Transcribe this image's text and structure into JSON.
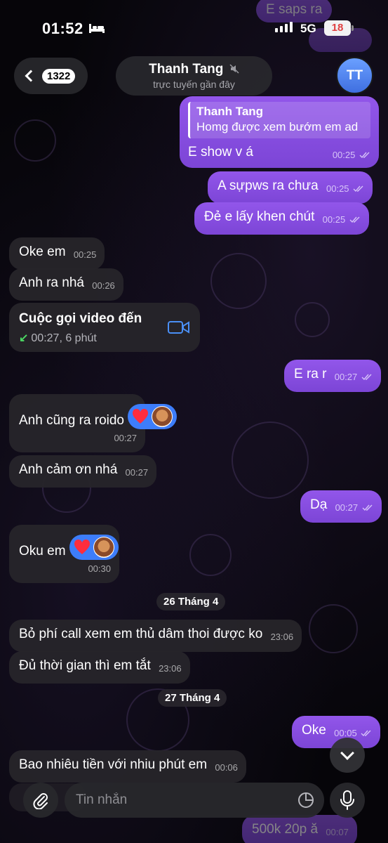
{
  "status_bar": {
    "time": "01:52",
    "network": "5G",
    "battery": "18"
  },
  "header": {
    "back_count": "1322",
    "contact_name": "Thanh Tang",
    "last_seen": "trực tuyến gần đây",
    "avatar_initials": "TT"
  },
  "colors": {
    "outgoing_bubble": "#8a4fe3",
    "incoming_bubble": "#26242a",
    "reaction_pill": "#3d7dfa",
    "accent_blue": "#3f6fe0"
  },
  "top_partial": {
    "text_a": "E saps ra"
  },
  "messages": {
    "m1": {
      "reply_author": "Thanh Tang",
      "reply_text": "Homg được xem bướm em ad",
      "text": "E show v á",
      "time": "00:25"
    },
    "m2": {
      "text": "A sựpws ra chưa",
      "time": "00:25"
    },
    "m3": {
      "text": "Đẻ e lấy khen chút",
      "time": "00:25"
    },
    "m4": {
      "text": "Oke em",
      "time": "00:25"
    },
    "m5": {
      "text": "Anh ra nhá",
      "time": "00:26"
    },
    "m6": {
      "title": "Cuộc gọi video đến",
      "sub_arrow": "↙",
      "sub": "00:27, 6 phút"
    },
    "m7": {
      "text": "E ra r",
      "time": "00:27"
    },
    "m8": {
      "text": "Anh cũng ra roido",
      "time": "00:27"
    },
    "m9": {
      "text": "Anh cảm ơn nhá",
      "time": "00:27"
    },
    "m10": {
      "text": "Dạ",
      "time": "00:27"
    },
    "m11": {
      "text": "Oku em",
      "time": "00:30"
    },
    "d1": {
      "text": "26 Tháng 4"
    },
    "m12": {
      "text": "Bỏ phí call xem em thủ dâm thoi được ko",
      "time": "23:06"
    },
    "m13": {
      "text": "Đủ thời gian thì em tắt",
      "time": "23:06"
    },
    "d2": {
      "text": "27 Tháng 4"
    },
    "m14": {
      "text": "Oke",
      "time": "00:05"
    },
    "m15": {
      "text": "Bao nhiêu tiền với nhiu phút em",
      "time": "00:06"
    },
    "m16": {
      "text": "500k 20p ă",
      "time": "00:07"
    }
  },
  "composer": {
    "placeholder": "Tin nhắn"
  }
}
